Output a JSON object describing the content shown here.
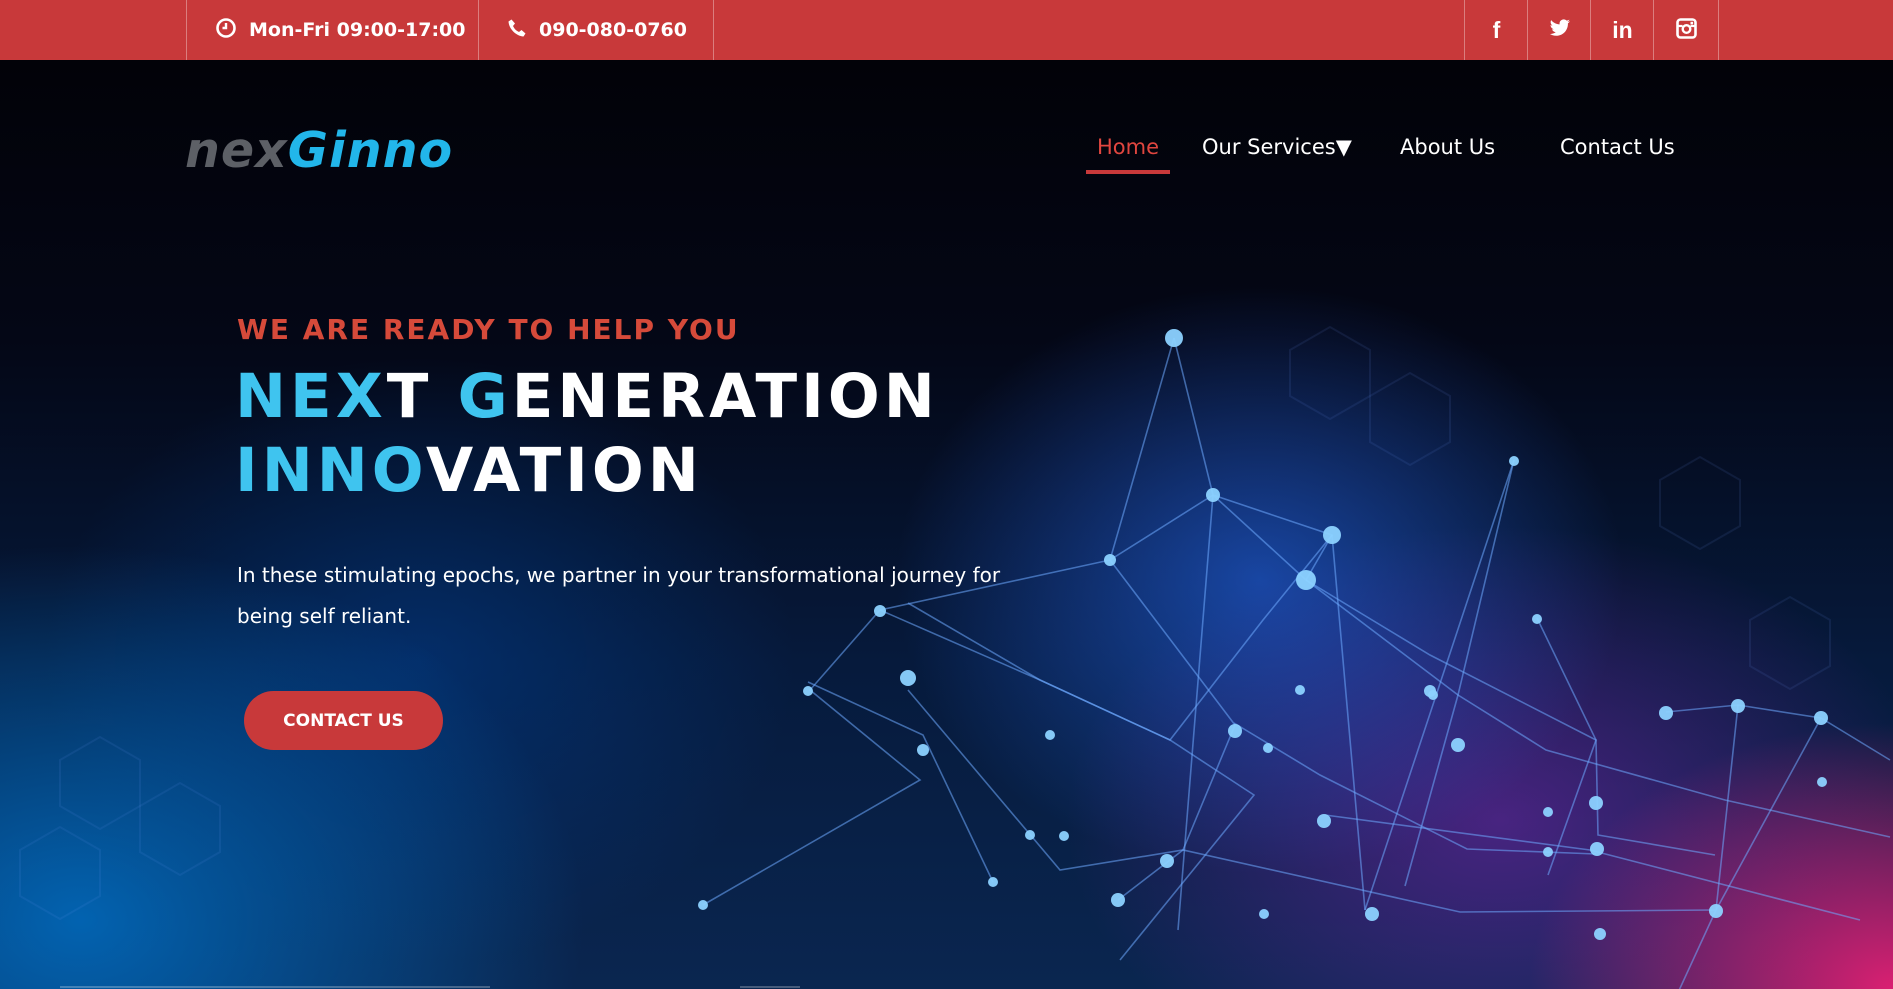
{
  "topbar": {
    "hours": "Mon-Fri 09:00-17:00",
    "phone": "090-080-0760",
    "social": [
      "facebook-icon",
      "twitter-icon",
      "linkedin-icon",
      "instagram-icon"
    ],
    "background": "#c8393a"
  },
  "logo": {
    "part1": "nex",
    "part2": "Ginno"
  },
  "nav": {
    "items": [
      {
        "label": "Home",
        "active": true
      },
      {
        "label": "Our Services▼"
      },
      {
        "label": "About Us"
      },
      {
        "label": "Contact Us"
      }
    ],
    "active_color": "#e0463f"
  },
  "hero": {
    "eyebrow": "WE ARE READY TO HELP YOU",
    "headline": {
      "line1": [
        {
          "text": "NEX",
          "highlight": true
        },
        {
          "text": "T ",
          "highlight": false
        },
        {
          "text": "G",
          "highlight": true
        },
        {
          "text": "ENERATION",
          "highlight": false
        }
      ],
      "line2": [
        {
          "text": "INNO",
          "highlight": true
        },
        {
          "text": "VATION",
          "highlight": false
        }
      ]
    },
    "paragraph": "In these stimulating epochs, we partner in your transformational journey for being self reliant.",
    "cta": "CONTACT US",
    "highlight_color": "#3fc4ef",
    "eyebrow_color": "#d64a3a"
  }
}
